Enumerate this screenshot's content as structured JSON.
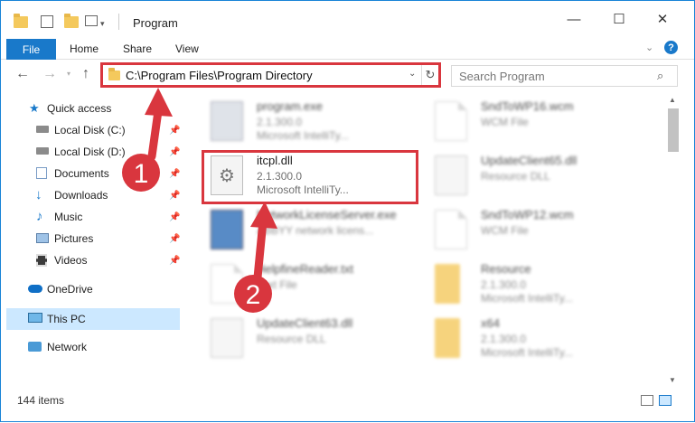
{
  "window": {
    "title": "Program",
    "controls": {
      "minimize": "—",
      "maximize": "☐",
      "close": "✕"
    }
  },
  "ribbon": {
    "tabs": [
      "File",
      "Home",
      "Share",
      "View"
    ],
    "help": "?"
  },
  "address_bar": {
    "path": "C:\\Program Files\\Program Directory",
    "dropdown_icon": "chevron-down-icon",
    "refresh_icon": "refresh-icon"
  },
  "search": {
    "placeholder": "Search Program",
    "icon": "search-icon"
  },
  "sidebar": {
    "items": [
      {
        "label": "Quick access",
        "icon": "star-icon"
      },
      {
        "label": "Local Disk (C:)",
        "icon": "drive-icon",
        "pinned": true
      },
      {
        "label": "Local Disk (D:)",
        "icon": "drive-icon",
        "pinned": true
      },
      {
        "label": "Documents",
        "icon": "documents-icon",
        "pinned": true
      },
      {
        "label": "Downloads",
        "icon": "downloads-icon",
        "pinned": true
      },
      {
        "label": "Music",
        "icon": "music-icon",
        "pinned": true
      },
      {
        "label": "Pictures",
        "icon": "pictures-icon",
        "pinned": true
      },
      {
        "label": "Videos",
        "icon": "videos-icon",
        "pinned": true
      },
      {
        "label": "OneDrive",
        "icon": "cloud-icon"
      },
      {
        "label": "This PC",
        "icon": "monitor-icon",
        "selected": true
      },
      {
        "label": "Network",
        "icon": "network-icon"
      }
    ]
  },
  "files": [
    {
      "name": "program.exe",
      "line1": "2.1.300.0",
      "line2": "Microsoft IntelliTy...",
      "icon": "exe-icon"
    },
    {
      "name": "SndToWP16.wcm",
      "line1": "WCM File",
      "line2": "",
      "icon": "document-icon"
    },
    {
      "name": "itcpl.dll",
      "line1": "2.1.300.0",
      "line2": "Microsoft IntelliTy...",
      "icon": "dll-gear-icon"
    },
    {
      "name": "UpdateClient65.dll",
      "line1": "Resource DLL",
      "line2": "",
      "icon": "dll-gear-icon"
    },
    {
      "name": "NetworkLicenseServer.exe",
      "line1": "ABBYY network licens...",
      "line2": "",
      "icon": "exe-icon"
    },
    {
      "name": "SndToWP12.wcm",
      "line1": "WCM File",
      "line2": "",
      "icon": "document-icon"
    },
    {
      "name": "HelpfineReader.txt",
      "line1": "Text File",
      "line2": "",
      "icon": "text-file-icon"
    },
    {
      "name": "Resource",
      "line1": "2.1.300.0",
      "line2": "Microsoft IntelliTy...",
      "icon": "folder-icon"
    },
    {
      "name": "UpdateClient63.dll",
      "line1": "Resource DLL",
      "line2": "",
      "icon": "dll-gear-icon"
    },
    {
      "name": "x64",
      "line1": "2.1.300.0",
      "line2": "Microsoft IntelliTy...",
      "icon": "folder-icon"
    }
  ],
  "callouts": [
    "1",
    "2"
  ],
  "status": {
    "item_count": "144 items"
  },
  "colors": {
    "accent": "#1979ca",
    "callout_red": "#d9363e",
    "folder": "#f4c95d",
    "selection": "#cce8ff"
  }
}
